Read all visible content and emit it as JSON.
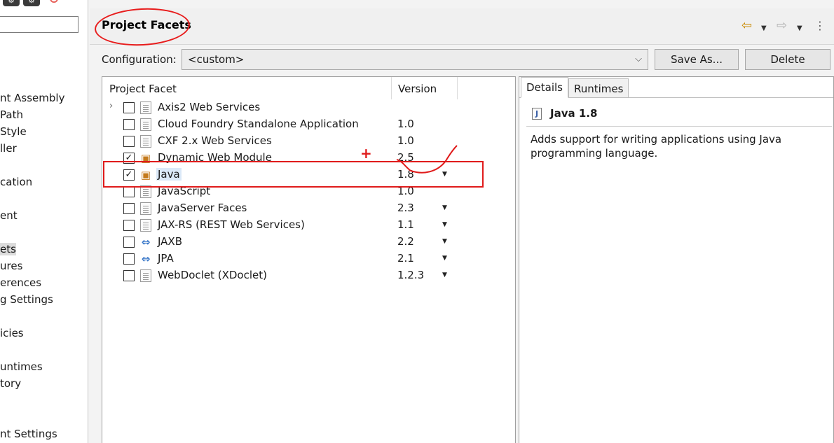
{
  "left_nav": {
    "filter_placeholder": "",
    "items": [
      {
        "label": "nt Assembly",
        "selected": false
      },
      {
        "label": "Path",
        "selected": false
      },
      {
        "label": "Style",
        "selected": false
      },
      {
        "label": "ller",
        "selected": false
      },
      {
        "label": "cation",
        "selected": false
      },
      {
        "label": "ent",
        "selected": false
      },
      {
        "label": "ets",
        "selected": true
      },
      {
        "label": "ures",
        "selected": false
      },
      {
        "label": "erences",
        "selected": false
      },
      {
        "label": "g Settings",
        "selected": false
      },
      {
        "label": "icies",
        "selected": false
      },
      {
        "label": "untimes",
        "selected": false
      },
      {
        "label": "tory",
        "selected": false
      },
      {
        "label": "nt Settings",
        "selected": false
      }
    ]
  },
  "header": {
    "title": "Project Facets",
    "icons": [
      "back-arrow-icon",
      "dropdown-icon",
      "forward-arrow-icon",
      "dropdown-icon",
      "view-menu-icon"
    ]
  },
  "configuration": {
    "label": "Configuration:",
    "selected": "<custom>",
    "save_as_label": "Save As...",
    "delete_label": "Delete"
  },
  "facets": {
    "col_facet": "Project Facet",
    "col_version": "Version",
    "rows": [
      {
        "name": "Axis2 Web Services",
        "version": "",
        "checked": false,
        "expandable": true,
        "icon": "document-icon",
        "dropdown": false
      },
      {
        "name": "Cloud Foundry Standalone Application",
        "version": "1.0",
        "checked": false,
        "expandable": false,
        "icon": "document-icon",
        "dropdown": false
      },
      {
        "name": "CXF 2.x Web Services",
        "version": "1.0",
        "checked": false,
        "expandable": false,
        "icon": "document-icon",
        "dropdown": false
      },
      {
        "name": "Dynamic Web Module",
        "version": "2.5",
        "checked": true,
        "expandable": false,
        "icon": "locked-module-icon",
        "dropdown": false
      },
      {
        "name": "Java",
        "version": "1.8",
        "checked": true,
        "expandable": false,
        "icon": "locked-module-icon",
        "dropdown": true,
        "highlighted": true
      },
      {
        "name": "JavaScript",
        "version": "1.0",
        "checked": false,
        "expandable": false,
        "icon": "document-icon",
        "dropdown": false
      },
      {
        "name": "JavaServer Faces",
        "version": "2.3",
        "checked": false,
        "expandable": false,
        "icon": "document-icon",
        "dropdown": true
      },
      {
        "name": "JAX-RS (REST Web Services)",
        "version": "1.1",
        "checked": false,
        "expandable": false,
        "icon": "document-icon",
        "dropdown": true
      },
      {
        "name": "JAXB",
        "version": "2.2",
        "checked": false,
        "expandable": false,
        "icon": "arrows-icon",
        "dropdown": true
      },
      {
        "name": "JPA",
        "version": "2.1",
        "checked": false,
        "expandable": false,
        "icon": "arrows-icon",
        "dropdown": true
      },
      {
        "name": "WebDoclet (XDoclet)",
        "version": "1.2.3",
        "checked": false,
        "expandable": false,
        "icon": "document-icon",
        "dropdown": true
      }
    ]
  },
  "details": {
    "tab_details": "Details",
    "tab_runtimes": "Runtimes",
    "title": "Java 1.8",
    "description": "Adds support for writing applications using Java programming language."
  },
  "annotations": {
    "plus": "+",
    "color": "#e01b1b"
  }
}
